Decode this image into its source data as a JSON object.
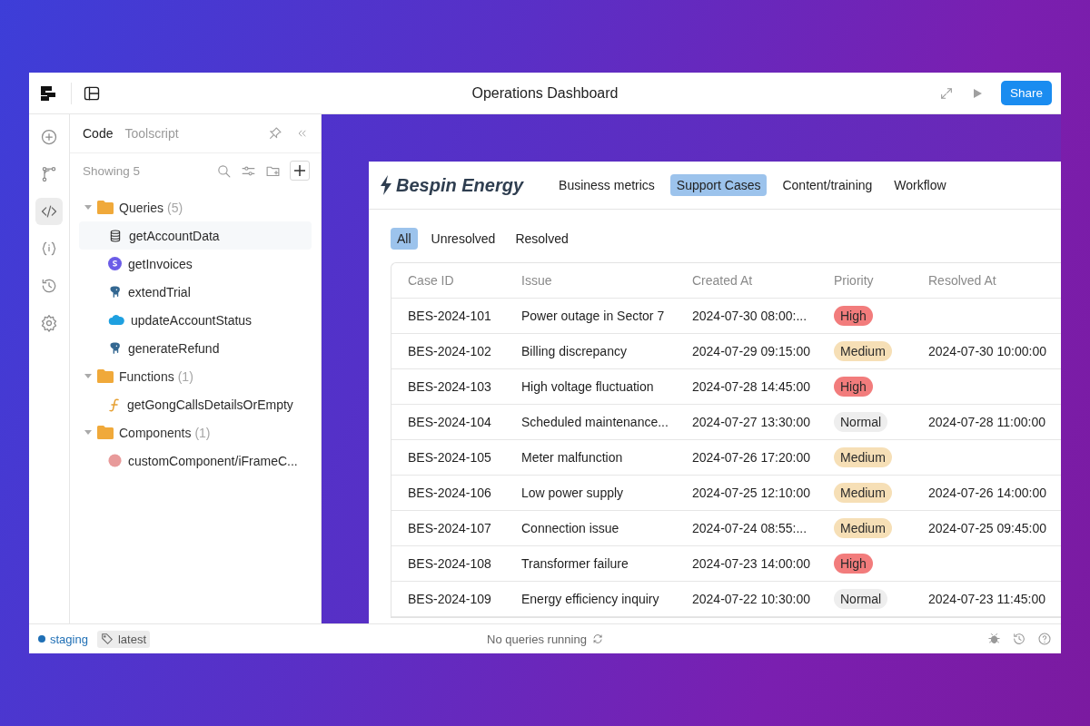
{
  "window": {
    "title": "Operations Dashboard",
    "share_label": "Share"
  },
  "rail": [
    {
      "kind": "add",
      "selected": false
    },
    {
      "kind": "branch",
      "selected": false
    },
    {
      "kind": "code",
      "selected": true
    },
    {
      "kind": "state",
      "selected": false
    },
    {
      "kind": "history",
      "selected": false
    },
    {
      "kind": "settings",
      "selected": false
    }
  ],
  "panel": {
    "tabs": [
      {
        "label": "Code",
        "selected": true
      },
      {
        "label": "Toolscript",
        "selected": false
      }
    ],
    "count_label": "Showing 5",
    "tree": [
      {
        "label": "Queries",
        "count": "(5)",
        "expanded": true,
        "children": [
          {
            "label": "getAccountData",
            "kind": "database",
            "selected": true
          },
          {
            "label": "getInvoices",
            "kind": "stripe",
            "selected": false
          },
          {
            "label": "extendTrial",
            "kind": "postgres",
            "selected": false
          },
          {
            "label": "updateAccountStatus",
            "kind": "cloud",
            "selected": false
          },
          {
            "label": "generateRefund",
            "kind": "postgres",
            "selected": false
          }
        ]
      },
      {
        "label": "Functions",
        "count": "(1)",
        "expanded": true,
        "children": [
          {
            "label": "getGongCallsDetailsOrEmpty",
            "kind": "function",
            "selected": false
          }
        ]
      },
      {
        "label": "Components",
        "count": "(1)",
        "expanded": true,
        "children": [
          {
            "label": "customComponent/iFrameC...",
            "kind": "component",
            "selected": false
          }
        ]
      }
    ]
  },
  "app": {
    "brand": "Bespin Energy",
    "nav": [
      {
        "label": "Business metrics",
        "selected": false
      },
      {
        "label": "Support Cases",
        "selected": true
      },
      {
        "label": "Content/training",
        "selected": false
      },
      {
        "label": "Workflow",
        "selected": false
      }
    ],
    "filters": [
      {
        "label": "All",
        "selected": true
      },
      {
        "label": "Unresolved",
        "selected": false
      },
      {
        "label": "Resolved",
        "selected": false
      }
    ],
    "table": {
      "columns": [
        "Case ID",
        "Issue",
        "Created At",
        "Priority",
        "Resolved At"
      ],
      "rows": [
        {
          "case_id": "BES-2024-101",
          "issue": "Power outage in Sector 7",
          "created_at": "2024-07-30 08:00:...",
          "priority": "High",
          "color": "#f27c7c"
        },
        {
          "case_id": "BES-2024-102",
          "issue": "Billing discrepancy",
          "created_at": "2024-07-29 09:15:00",
          "priority": "Medium",
          "color": "#f6dfb6",
          "resolved_at": "2024-07-30 10:00:00"
        },
        {
          "case_id": "BES-2024-103",
          "issue": "High voltage fluctuation",
          "created_at": "2024-07-28 14:45:00",
          "priority": "High",
          "color": "#f27c7c"
        },
        {
          "case_id": "BES-2024-104",
          "issue": "Scheduled maintenance...",
          "created_at": "2024-07-27 13:30:00",
          "priority": "Normal",
          "color": "#eeeeee",
          "resolved_at": "2024-07-28 11:00:00"
        },
        {
          "case_id": "BES-2024-105",
          "issue": "Meter malfunction",
          "created_at": "2024-07-26 17:20:00",
          "priority": "Medium",
          "color": "#f6dfb6"
        },
        {
          "case_id": "BES-2024-106",
          "issue": "Low power supply",
          "created_at": "2024-07-25 12:10:00",
          "priority": "Medium",
          "color": "#f6dfb6",
          "resolved_at": "2024-07-26 14:00:00"
        },
        {
          "case_id": "BES-2024-107",
          "issue": "Connection issue",
          "created_at": "2024-07-24 08:55:...",
          "priority": "Medium",
          "color": "#f6dfb6",
          "resolved_at": "2024-07-25 09:45:00"
        },
        {
          "case_id": "BES-2024-108",
          "issue": "Transformer failure",
          "created_at": "2024-07-23 14:00:00",
          "priority": "High",
          "color": "#f27c7c"
        },
        {
          "case_id": "BES-2024-109",
          "issue": "Energy efficiency inquiry",
          "created_at": "2024-07-22 10:30:00",
          "priority": "Normal",
          "color": "#eeeeee",
          "resolved_at": "2024-07-23 11:45:00"
        }
      ]
    }
  },
  "status_bar": {
    "environment": "staging",
    "version_tag": "latest",
    "message": "No queries running"
  }
}
